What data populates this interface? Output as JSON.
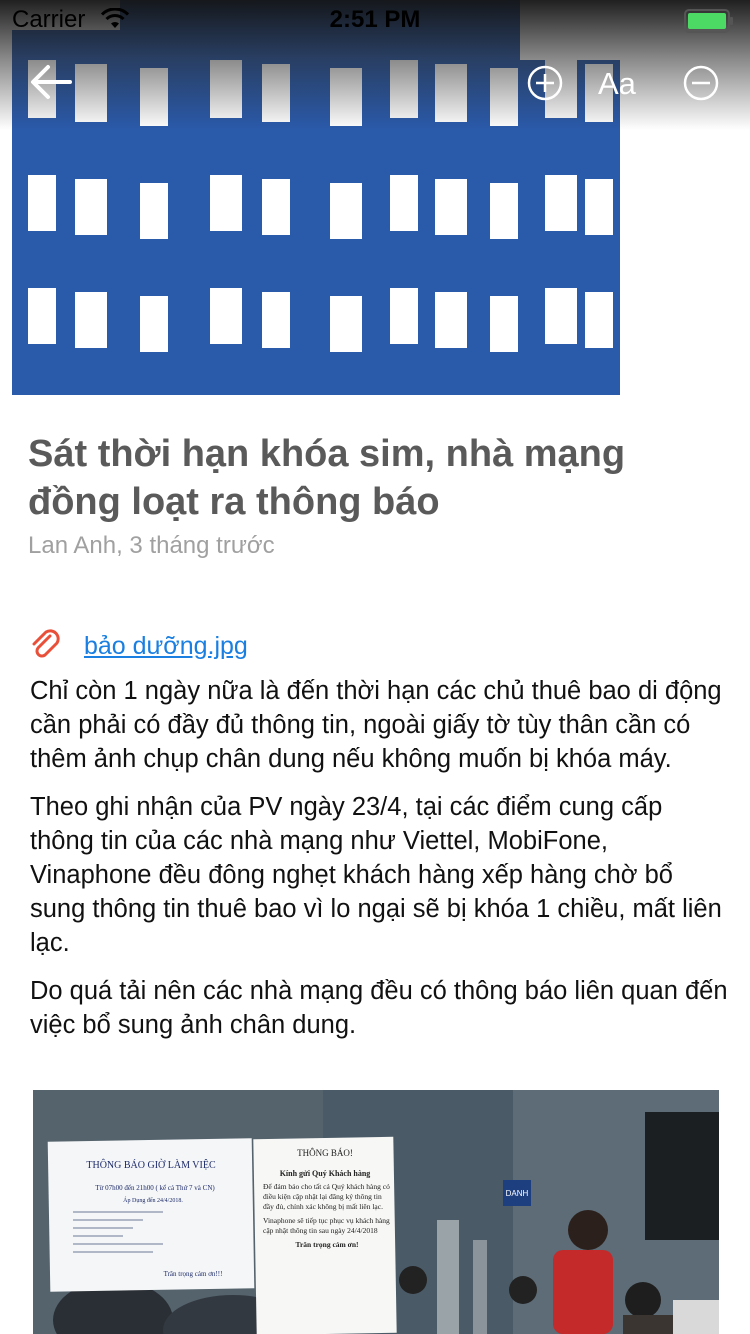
{
  "status_bar": {
    "carrier": "Carrier",
    "time": "2:51 PM",
    "battery_color": "#4cd964"
  },
  "toolbar": {
    "font_label": "Aa"
  },
  "article": {
    "title": "Sát thời hạn khóa sim, nhà mạng đồng loạt ra thông báo",
    "meta": "Lan Anh, 3 tháng trước",
    "attachment": "bảo dưỡng.jpg",
    "paragraphs": [
      "Chỉ còn 1 ngày nữa là đến thời hạn các chủ thuê bao di động cần phải có đầy đủ thông tin, ngoài giấy tờ tùy thân cần có thêm ảnh chụp chân dung nếu không muốn bị khóa máy.",
      "Theo ghi nhận của PV ngày 23/4, tại các điểm cung cấp thông tin của các nhà mạng như Viettel, MobiFone, Vinaphone đều đông nghẹt khách hàng xếp hàng chờ bổ sung thông tin thuê bao vì lo ngại sẽ bị khóa 1 chiều, mất liên lạc.",
      "Do quá tải nên các nhà mạng đều có thông báo liên quan đến việc bổ sung ảnh chân dung."
    ]
  },
  "notices": {
    "left_title": "THÔNG BÁO GIỜ LÀM VIỆC",
    "left_line1": "Từ 07h00 đến 21h00 ( kể cả Thứ 7 và CN)",
    "left_line2": "Áp Dụng đến 24/4/2018.",
    "left_thanks": "Trân trọng cảm ơn!!!",
    "right_title": "THÔNG BÁO!",
    "right_greeting": "Kính gửi Quý Khách hàng",
    "right_body": "Để đảm bảo cho tất cả Quý khách hàng có điều kiện cập nhật lại đăng ký thông tin đầy đủ, chính xác không bị mất liên lạc.",
    "right_body2": "Vinaphone sẽ tiếp tục phục vụ khách hàng cập nhật thông tin sau ngày 24/4/2018",
    "right_thanks": "Trân trọng cảm ơn!",
    "sign_text": "DANH"
  },
  "colors": {
    "building": "#2a5aaa",
    "link": "#1a7fe0",
    "paperclip": "#e8503a"
  }
}
